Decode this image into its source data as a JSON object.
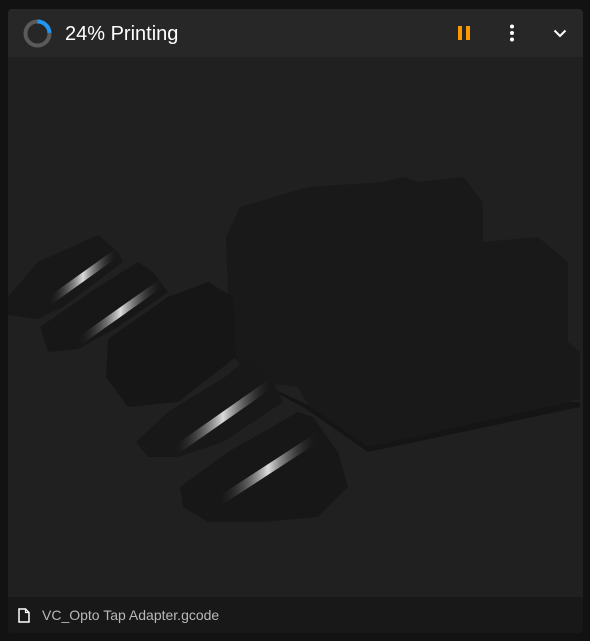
{
  "header": {
    "progress_percent": 24,
    "title": "24% Printing",
    "pause_icon": "pause-icon",
    "menu_icon": "dots-vertical-icon",
    "collapse_icon": "chevron-down-icon"
  },
  "preview": {
    "alt": "3D model preview"
  },
  "footer": {
    "file_icon": "file-icon",
    "filename": "VC_Opto Tap Adapter.gcode"
  },
  "colors": {
    "accent": "#2196f3",
    "pause": "#ff9800",
    "card_bg": "#1e1e1e",
    "header_bg": "#272727"
  }
}
